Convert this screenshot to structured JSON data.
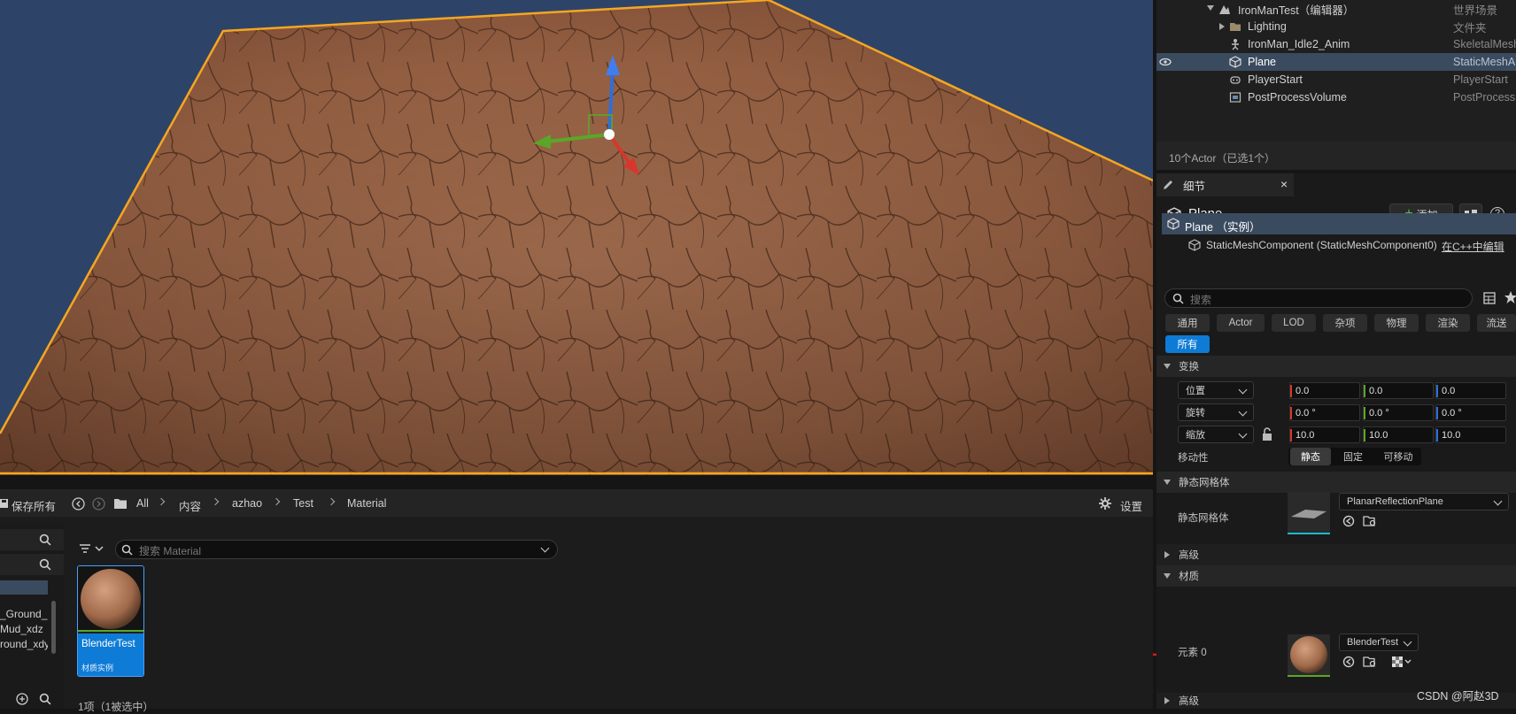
{
  "outliner": {
    "items": [
      {
        "name": "IronManTest（编辑器）",
        "type": "世界场景",
        "icon": "level-icon"
      },
      {
        "name": "Lighting",
        "type": "文件夹",
        "icon": "folder-icon"
      },
      {
        "name": "IronMan_Idle2_Anim",
        "type": "SkeletalMesh",
        "icon": "skeletal-mesh-icon"
      },
      {
        "name": "Plane",
        "type": "StaticMeshA",
        "icon": "static-mesh-icon",
        "selected": true
      },
      {
        "name": "PlayerStart",
        "type": "PlayerStart",
        "icon": "player-start-icon"
      },
      {
        "name": "PostProcessVolume",
        "type": "PostProcess",
        "icon": "post-process-icon"
      }
    ],
    "actor_count": "10个Actor（已选1个）"
  },
  "details": {
    "tab_label": "细节",
    "object_name": "Plane",
    "add_label": "添加",
    "instance_label": "Plane （实例）",
    "component_label": "StaticMeshComponent (StaticMeshComponent0)",
    "component_link": "在C++中编辑",
    "search_placeholder": "搜索",
    "categories": [
      "通用",
      "Actor",
      "LOD",
      "杂项",
      "物理",
      "渲染",
      "流送"
    ],
    "active_category": "所有",
    "transform": {
      "section": "变换",
      "location": {
        "label": "位置",
        "x": "0.0",
        "y": "0.0",
        "z": "0.0"
      },
      "rotation": {
        "label": "旋转",
        "x": "0.0 °",
        "y": "0.0 °",
        "z": "0.0 °"
      },
      "scale": {
        "label": "缩放",
        "x": "10.0",
        "y": "10.0",
        "z": "10.0"
      },
      "mobility_label": "移动性",
      "mobility_options": [
        "静态",
        "固定",
        "可移动"
      ],
      "mobility_selected": "静态"
    },
    "static_mesh": {
      "section": "静态网格体",
      "label": "静态网格体",
      "value": "PlanarReflectionPlane"
    },
    "advanced_label": "高级",
    "materials": {
      "section": "材质",
      "element_label": "元素 0",
      "value": "BlenderTest"
    },
    "advanced_label_2": "高级"
  },
  "content_browser": {
    "save_all": "保存所有",
    "breadcrumbs": [
      "All",
      "内容",
      "azhao",
      "Test",
      "Material"
    ],
    "settings": "设置",
    "search_placeholder": "搜索 Material",
    "tree_items": [
      "_Ground_",
      "Mud_xdz",
      "round_xdy"
    ],
    "asset": {
      "name": "BlenderTest",
      "type": "材质实例"
    },
    "status": "1项（1被选中）"
  },
  "watermark": "CSDN @阿赵3D",
  "colors": {
    "selection_outline": "#f5a623",
    "accent_blue": "#0e7bd6",
    "arrow_red": "#e0161b",
    "axis_x": "#d8362c",
    "axis_y": "#5aa727",
    "axis_z": "#2f6ed8"
  }
}
